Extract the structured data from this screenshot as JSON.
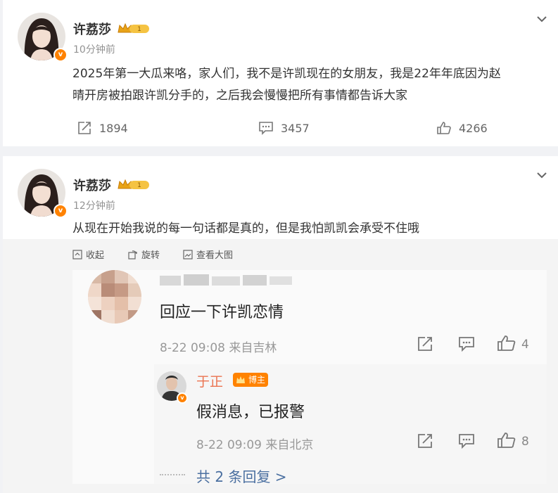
{
  "post1": {
    "user": "许荔莎",
    "level": "1",
    "time": "10分钟前",
    "text_line1": "2025年第一大瓜来咯，家人们，我不是许凯现在的女朋友，我是22年年底因为赵",
    "text_line2": "晴开房被拍跟许凯分手的，之后我会慢慢把所有事情都告诉大家",
    "repost_count": "1894",
    "comment_count": "3457",
    "like_count": "4266"
  },
  "post2": {
    "user": "许荔莎",
    "level": "1",
    "time": "12分钟前",
    "text": "从现在开始我说的每一句话都是真的，但是我怕凯凯会承受不住哦",
    "media_actions": {
      "collapse": "收起",
      "rotate": "旋转",
      "view_large": "查看大图"
    },
    "comment": {
      "text": "回应一下许凯恋情",
      "meta": "8-22 09:08 来自吉林",
      "like_count": "4"
    },
    "reply": {
      "user": "于正",
      "badge": "博主",
      "text": "假消息，已报警",
      "meta": "8-22 09:09 来自北京",
      "like_count": "8"
    },
    "more_replies": "共 2 条回复 >"
  },
  "colors": {
    "accent_orange": "#ff8200",
    "reply_name": "#eb7350",
    "link_blue": "#4a6fa0"
  }
}
